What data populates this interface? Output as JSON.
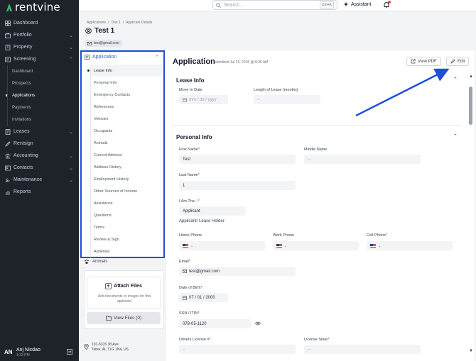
{
  "brand": {
    "name": "rentvine"
  },
  "sidebar": {
    "items": [
      {
        "label": "Dashboard",
        "icon": "dashboard-icon"
      },
      {
        "label": "Portfolio",
        "icon": "portfolio-icon",
        "chevron": "down"
      },
      {
        "label": "Property",
        "icon": "property-icon",
        "chevron": "down"
      },
      {
        "label": "Screening",
        "icon": "screening-icon",
        "chevron": "up"
      }
    ],
    "screening_sub": [
      "Dashboard",
      "Prospects",
      "Applications",
      "Payments",
      "Invitations"
    ],
    "active_sub": "Applications",
    "items_after": [
      {
        "label": "Leases",
        "icon": "leases-icon",
        "chevron": "down"
      },
      {
        "label": "Rentsign",
        "icon": "rentsign-icon"
      },
      {
        "label": "Accounting",
        "icon": "accounting-icon",
        "chevron": "down"
      },
      {
        "label": "Contacts",
        "icon": "contacts-icon",
        "chevron": "down"
      },
      {
        "label": "Maintenance",
        "icon": "maintenance-icon",
        "chevron": "down"
      },
      {
        "label": "Reports",
        "icon": "reports-icon"
      }
    ],
    "user": {
      "initials": "AN",
      "name": "Anj Nicdao",
      "time": "1:23 PM"
    }
  },
  "topbar": {
    "search_placeholder": "Search...",
    "shortcut": "Ctrl+K",
    "assistant_label": "Assistant"
  },
  "breadcrumb": [
    "Applications",
    "/",
    "Test 1",
    "/",
    "Applicant Details"
  ],
  "applicant": {
    "name": "Test 1",
    "email": "test@gmail.com"
  },
  "application_nav": {
    "header": "Application",
    "items": [
      "Lease Info",
      "Personal Info",
      "Emergency Contacts",
      "References",
      "Vehicles",
      "Occupants",
      "Animals",
      "Current Address",
      "Address History",
      "Employment History",
      "Other Sources of Income",
      "Assistance",
      "Questions",
      "Terms",
      "Review & Sign",
      "Addenda"
    ],
    "active": "Lease Info"
  },
  "animals_label": "Animals",
  "attachments": {
    "title": "Attach Files",
    "description": "Add documents or images for this applicant",
    "view_files": "View Files (0)"
  },
  "address": {
    "line1": "101-5315 38 Ave",
    "line2": "Taber, AL T1G 1N4, US"
  },
  "application": {
    "title": "Application",
    "submitted": "Submitted Jul 23, 2026 @ 8:35 AM",
    "view_pdf": "View PDF",
    "edit": "Edit"
  },
  "lease_info": {
    "title": "Lease Info",
    "move_in_label": "Move In Date",
    "move_in_placeholder": "mm / dd / yyyy",
    "length_label": "Length of Lease (months)",
    "length_value": "--"
  },
  "personal_info": {
    "title": "Personal Info",
    "first_name_label": "First Name",
    "first_name": "Test",
    "middle_name_label": "Middle Name",
    "middle_name": "--",
    "last_name_label": "Last Name",
    "last_name": "1",
    "i_am_label": "I Am The...",
    "i_am_value": "Applicant",
    "i_am_note": "Applicant/ Lease Holder",
    "home_phone_label": "Home Phone",
    "work_phone_label": "Work Phone",
    "cell_phone_label": "Cell Phone",
    "email_label": "Email",
    "email": "test@gmail.com",
    "dob_label": "Date of Birth",
    "dob": "07 / 01 / 2000",
    "ssn_label": "SSN / ITIN",
    "ssn": "078-05-1120",
    "license_label": "Drivers License #",
    "license": "--",
    "license_state_label": "License State",
    "license_state": "--"
  },
  "colors": {
    "sidebar": "#1e2229",
    "accent": "#2563eb",
    "highlight_box": "#1f4fd8",
    "required": "#dc2626"
  }
}
